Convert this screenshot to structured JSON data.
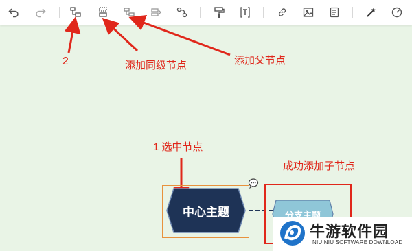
{
  "toolbar": {
    "buttons": [
      {
        "name": "undo",
        "icon": "undo-icon"
      },
      {
        "name": "redo",
        "icon": "redo-icon"
      },
      {
        "name": "add-child-node",
        "icon": "add-child-node-icon"
      },
      {
        "name": "add-sibling-node",
        "icon": "add-sibling-node-icon"
      },
      {
        "name": "add-parent-node",
        "icon": "add-parent-node-icon"
      },
      {
        "name": "add-summary",
        "icon": "summary-icon"
      },
      {
        "name": "relation-line",
        "icon": "relation-line-icon"
      },
      {
        "name": "format-painter",
        "icon": "format-painter-icon"
      },
      {
        "name": "text-style",
        "icon": "text-format-icon"
      },
      {
        "name": "link",
        "icon": "link-icon"
      },
      {
        "name": "image",
        "icon": "image-icon"
      },
      {
        "name": "note",
        "icon": "note-icon"
      },
      {
        "name": "magic",
        "icon": "magic-wand-icon"
      },
      {
        "name": "gauge",
        "icon": "gauge-icon"
      }
    ]
  },
  "annotations": {
    "step2": "2",
    "add_sibling": "添加同级节点",
    "add_parent": "添加父节点",
    "select_node": "1 选中节点",
    "success": "成功添加子节点"
  },
  "canvas": {
    "center_node": "中心主题",
    "branch_node": "分支主题"
  },
  "watermark": {
    "name_cn": "牛游软件园",
    "name_en": "NIU NIU SOFTWARE DOWNLOAD"
  },
  "colors": {
    "canvas_bg": "#e9f4e6",
    "center_node_fill": "#1e3356",
    "branch_node_fill": "#8fc6d8",
    "annotation_red": "#e0271b",
    "selection_orange": "#e8923d"
  }
}
